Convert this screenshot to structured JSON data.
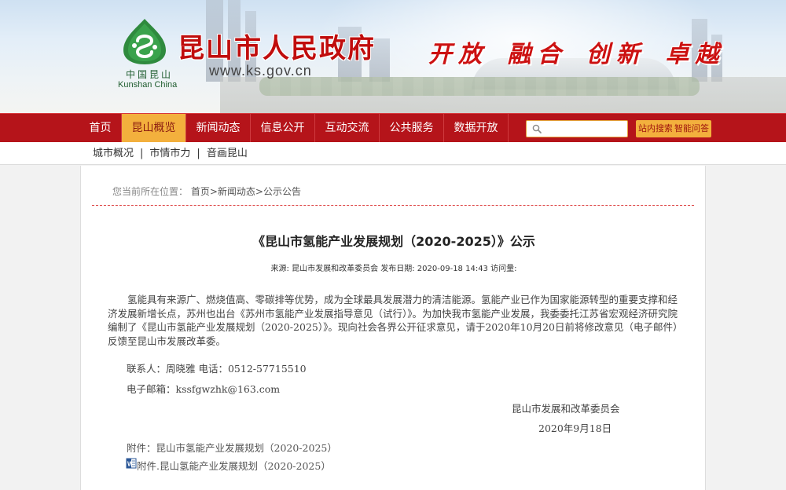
{
  "header": {
    "logo_cn": "中国昆山",
    "logo_en": "Kunshan China",
    "site_title": "昆山市人民政府",
    "site_url": "www.ks.gov.cn",
    "slogan": "开放 融合 创新 卓越"
  },
  "nav": {
    "items": [
      "首页",
      "昆山概览",
      "新闻动态",
      "信息公开",
      "互动交流",
      "公共服务",
      "数据开放"
    ],
    "active_index": 1,
    "search_placeholder": "",
    "site_search_label": "站内搜索",
    "smart_qa_label": "智能问答"
  },
  "subnav": {
    "items": [
      "城市概况",
      "市情市力",
      "音画昆山"
    ]
  },
  "breadcrumb": {
    "prefix": "您当前所在位置：",
    "path": "首页>新闻动态>公示公告"
  },
  "article": {
    "title": "《昆山市氢能产业发展规划（2020-2025）》公示",
    "meta": "来源:   昆山市发展和改革委员会  发布日期: 2020-09-18 14:43   访问量:",
    "body": "氢能具有来源广、燃烧值高、零碳排等优势，成为全球最具发展潜力的清洁能源。氢能产业已作为国家能源转型的重要支撑和经济发展新增长点，苏州也出台《苏州市氢能产业发展指导意见（试行）》。为加快我市氢能产业发展，我委委托江苏省宏观经济研究院编制了《昆山市氢能产业发展规划（2020-2025）》。现向社会各界公开征求意见，请于2020年10月20日前将修改意见（电子邮件）反馈至昆山市发展改革委。",
    "contact": "联系人：周晓雅        电话：0512-57715510",
    "email": "电子邮箱：kssfgwzhk@163.com",
    "signer": "昆山市发展和改革委员会",
    "date": "2020年9月18日",
    "attachment_note": "附件：昆山市氢能产业发展规划（2020-2025）",
    "attachment_link": "附件.昆山氢能产业发展规划（2020-2025）"
  },
  "colors": {
    "nav_bg": "#b5141a",
    "nav_active": "#f3b03d",
    "title_red": "#c00d0d"
  }
}
